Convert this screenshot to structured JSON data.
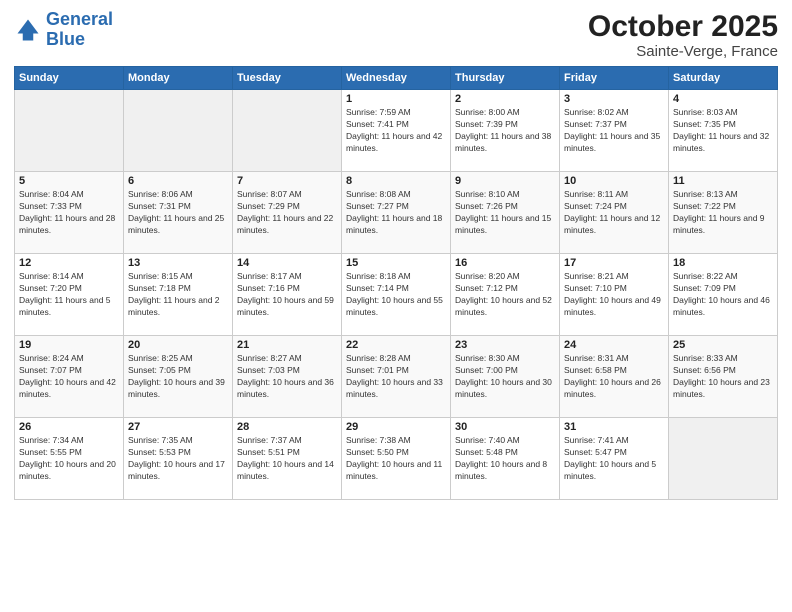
{
  "logo": {
    "line1": "General",
    "line2": "Blue"
  },
  "header": {
    "month": "October 2025",
    "location": "Sainte-Verge, France"
  },
  "weekdays": [
    "Sunday",
    "Monday",
    "Tuesday",
    "Wednesday",
    "Thursday",
    "Friday",
    "Saturday"
  ],
  "weeks": [
    [
      {
        "day": "",
        "sunrise": "",
        "sunset": "",
        "daylight": ""
      },
      {
        "day": "",
        "sunrise": "",
        "sunset": "",
        "daylight": ""
      },
      {
        "day": "",
        "sunrise": "",
        "sunset": "",
        "daylight": ""
      },
      {
        "day": "1",
        "sunrise": "Sunrise: 7:59 AM",
        "sunset": "Sunset: 7:41 PM",
        "daylight": "Daylight: 11 hours and 42 minutes."
      },
      {
        "day": "2",
        "sunrise": "Sunrise: 8:00 AM",
        "sunset": "Sunset: 7:39 PM",
        "daylight": "Daylight: 11 hours and 38 minutes."
      },
      {
        "day": "3",
        "sunrise": "Sunrise: 8:02 AM",
        "sunset": "Sunset: 7:37 PM",
        "daylight": "Daylight: 11 hours and 35 minutes."
      },
      {
        "day": "4",
        "sunrise": "Sunrise: 8:03 AM",
        "sunset": "Sunset: 7:35 PM",
        "daylight": "Daylight: 11 hours and 32 minutes."
      }
    ],
    [
      {
        "day": "5",
        "sunrise": "Sunrise: 8:04 AM",
        "sunset": "Sunset: 7:33 PM",
        "daylight": "Daylight: 11 hours and 28 minutes."
      },
      {
        "day": "6",
        "sunrise": "Sunrise: 8:06 AM",
        "sunset": "Sunset: 7:31 PM",
        "daylight": "Daylight: 11 hours and 25 minutes."
      },
      {
        "day": "7",
        "sunrise": "Sunrise: 8:07 AM",
        "sunset": "Sunset: 7:29 PM",
        "daylight": "Daylight: 11 hours and 22 minutes."
      },
      {
        "day": "8",
        "sunrise": "Sunrise: 8:08 AM",
        "sunset": "Sunset: 7:27 PM",
        "daylight": "Daylight: 11 hours and 18 minutes."
      },
      {
        "day": "9",
        "sunrise": "Sunrise: 8:10 AM",
        "sunset": "Sunset: 7:26 PM",
        "daylight": "Daylight: 11 hours and 15 minutes."
      },
      {
        "day": "10",
        "sunrise": "Sunrise: 8:11 AM",
        "sunset": "Sunset: 7:24 PM",
        "daylight": "Daylight: 11 hours and 12 minutes."
      },
      {
        "day": "11",
        "sunrise": "Sunrise: 8:13 AM",
        "sunset": "Sunset: 7:22 PM",
        "daylight": "Daylight: 11 hours and 9 minutes."
      }
    ],
    [
      {
        "day": "12",
        "sunrise": "Sunrise: 8:14 AM",
        "sunset": "Sunset: 7:20 PM",
        "daylight": "Daylight: 11 hours and 5 minutes."
      },
      {
        "day": "13",
        "sunrise": "Sunrise: 8:15 AM",
        "sunset": "Sunset: 7:18 PM",
        "daylight": "Daylight: 11 hours and 2 minutes."
      },
      {
        "day": "14",
        "sunrise": "Sunrise: 8:17 AM",
        "sunset": "Sunset: 7:16 PM",
        "daylight": "Daylight: 10 hours and 59 minutes."
      },
      {
        "day": "15",
        "sunrise": "Sunrise: 8:18 AM",
        "sunset": "Sunset: 7:14 PM",
        "daylight": "Daylight: 10 hours and 55 minutes."
      },
      {
        "day": "16",
        "sunrise": "Sunrise: 8:20 AM",
        "sunset": "Sunset: 7:12 PM",
        "daylight": "Daylight: 10 hours and 52 minutes."
      },
      {
        "day": "17",
        "sunrise": "Sunrise: 8:21 AM",
        "sunset": "Sunset: 7:10 PM",
        "daylight": "Daylight: 10 hours and 49 minutes."
      },
      {
        "day": "18",
        "sunrise": "Sunrise: 8:22 AM",
        "sunset": "Sunset: 7:09 PM",
        "daylight": "Daylight: 10 hours and 46 minutes."
      }
    ],
    [
      {
        "day": "19",
        "sunrise": "Sunrise: 8:24 AM",
        "sunset": "Sunset: 7:07 PM",
        "daylight": "Daylight: 10 hours and 42 minutes."
      },
      {
        "day": "20",
        "sunrise": "Sunrise: 8:25 AM",
        "sunset": "Sunset: 7:05 PM",
        "daylight": "Daylight: 10 hours and 39 minutes."
      },
      {
        "day": "21",
        "sunrise": "Sunrise: 8:27 AM",
        "sunset": "Sunset: 7:03 PM",
        "daylight": "Daylight: 10 hours and 36 minutes."
      },
      {
        "day": "22",
        "sunrise": "Sunrise: 8:28 AM",
        "sunset": "Sunset: 7:01 PM",
        "daylight": "Daylight: 10 hours and 33 minutes."
      },
      {
        "day": "23",
        "sunrise": "Sunrise: 8:30 AM",
        "sunset": "Sunset: 7:00 PM",
        "daylight": "Daylight: 10 hours and 30 minutes."
      },
      {
        "day": "24",
        "sunrise": "Sunrise: 8:31 AM",
        "sunset": "Sunset: 6:58 PM",
        "daylight": "Daylight: 10 hours and 26 minutes."
      },
      {
        "day": "25",
        "sunrise": "Sunrise: 8:33 AM",
        "sunset": "Sunset: 6:56 PM",
        "daylight": "Daylight: 10 hours and 23 minutes."
      }
    ],
    [
      {
        "day": "26",
        "sunrise": "Sunrise: 7:34 AM",
        "sunset": "Sunset: 5:55 PM",
        "daylight": "Daylight: 10 hours and 20 minutes."
      },
      {
        "day": "27",
        "sunrise": "Sunrise: 7:35 AM",
        "sunset": "Sunset: 5:53 PM",
        "daylight": "Daylight: 10 hours and 17 minutes."
      },
      {
        "day": "28",
        "sunrise": "Sunrise: 7:37 AM",
        "sunset": "Sunset: 5:51 PM",
        "daylight": "Daylight: 10 hours and 14 minutes."
      },
      {
        "day": "29",
        "sunrise": "Sunrise: 7:38 AM",
        "sunset": "Sunset: 5:50 PM",
        "daylight": "Daylight: 10 hours and 11 minutes."
      },
      {
        "day": "30",
        "sunrise": "Sunrise: 7:40 AM",
        "sunset": "Sunset: 5:48 PM",
        "daylight": "Daylight: 10 hours and 8 minutes."
      },
      {
        "day": "31",
        "sunrise": "Sunrise: 7:41 AM",
        "sunset": "Sunset: 5:47 PM",
        "daylight": "Daylight: 10 hours and 5 minutes."
      },
      {
        "day": "",
        "sunrise": "",
        "sunset": "",
        "daylight": ""
      }
    ]
  ]
}
